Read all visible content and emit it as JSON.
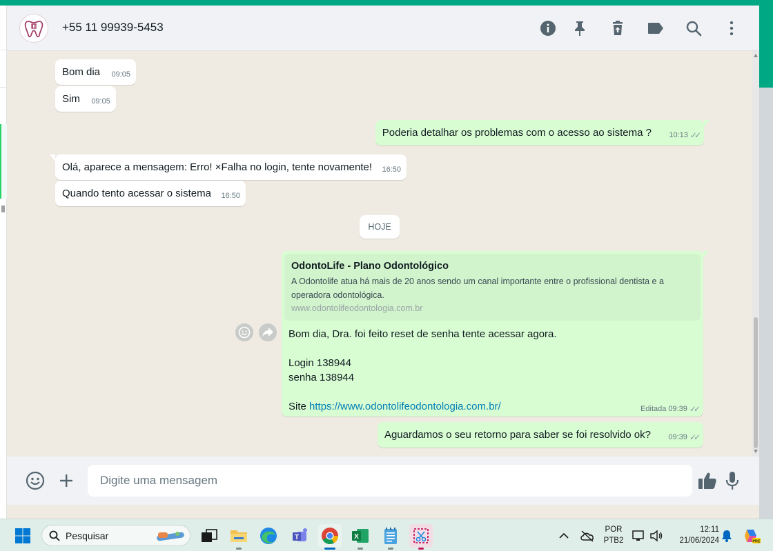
{
  "header": {
    "contact_name": "+55 11 99939-5453",
    "icons": [
      "info-icon",
      "pin-icon",
      "delete-icon",
      "label-icon",
      "search-icon",
      "menu-icon"
    ]
  },
  "messages": [
    {
      "direction": "in",
      "text": "Bom dia",
      "time": "09:05"
    },
    {
      "direction": "in",
      "text": "Sim",
      "time": "09:05"
    },
    {
      "direction": "out",
      "text": "Poderia detalhar os problemas com o acesso ao sistema ?",
      "time": "10:13",
      "status": "read"
    },
    {
      "direction": "in",
      "text": "Olá, aparece a mensagem: Erro! ×Falha no login, tente novamente!",
      "time": "16:50"
    },
    {
      "direction": "in",
      "text": "Quando tento acessar o sistema",
      "time": "16:50"
    }
  ],
  "day_divider": "HOJE",
  "link_message": {
    "preview_title": "OdontoLife - Plano Odontológico",
    "preview_description": "A Odontolife atua há mais de 20 anos sendo um canal importante entre o profissional dentista e a operadora odontológica.",
    "preview_url": "www.odontolifeodontologia.com.br",
    "line1": "Bom dia, Dra. foi feito reset de senha tente acessar agora.",
    "line2": "Login 138944",
    "line3": "senha 138944",
    "site_label": "Site",
    "link": "https://www.odontolifeodontologia.com.br/",
    "edited_label": "Editada",
    "time": "09:39"
  },
  "last_message": {
    "direction": "out",
    "text": "Aguardamos o seu retorno para saber se foi resolvido ok?",
    "time": "09:39"
  },
  "composer": {
    "placeholder": "Digite uma mensagem"
  },
  "taskbar": {
    "search_label": "Pesquisar",
    "lang_line1": "POR",
    "lang_line2": "PTB2",
    "clock_time": "12:11",
    "clock_date": "21/06/2024"
  },
  "colors": {
    "accent": "#00a884",
    "outgoing": "#d9fdd3",
    "incoming": "#ffffff",
    "chat_bg": "#efeae2",
    "link": "#027eb5"
  }
}
